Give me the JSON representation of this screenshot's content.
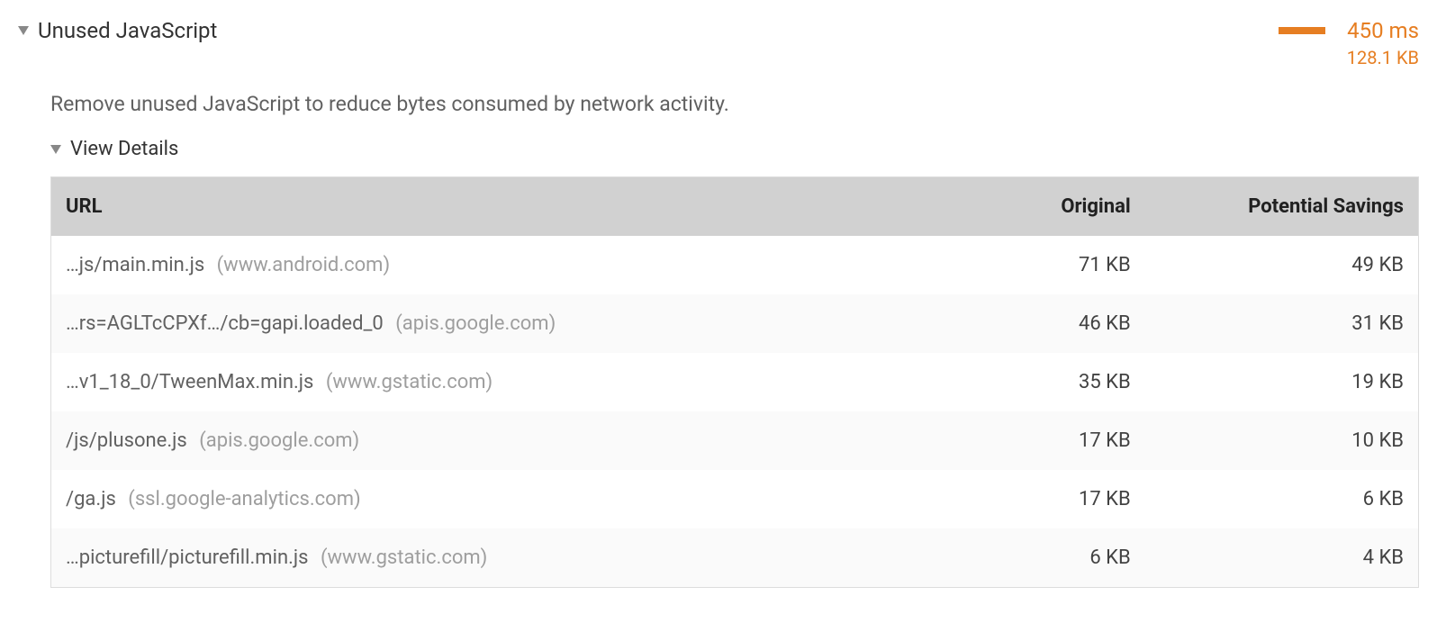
{
  "audit": {
    "title": "Unused JavaScript",
    "description": "Remove unused JavaScript to reduce bytes consumed by network activity.",
    "timing": "450 ms",
    "total_savings": "128.1 KB",
    "details_label": "View Details",
    "table": {
      "headers": {
        "url": "URL",
        "original": "Original",
        "savings": "Potential Savings"
      },
      "rows": [
        {
          "path": "…js/main.min.js",
          "host": "(www.android.com)",
          "original": "71 KB",
          "savings": "49 KB"
        },
        {
          "path": "…rs=AGLTcCPXf…/cb=gapi.loaded_0",
          "host": "(apis.google.com)",
          "original": "46 KB",
          "savings": "31 KB"
        },
        {
          "path": "…v1_18_0/TweenMax.min.js",
          "host": "(www.gstatic.com)",
          "original": "35 KB",
          "savings": "19 KB"
        },
        {
          "path": "/js/plusone.js",
          "host": "(apis.google.com)",
          "original": "17 KB",
          "savings": "10 KB"
        },
        {
          "path": "/ga.js",
          "host": "(ssl.google-analytics.com)",
          "original": "17 KB",
          "savings": "6 KB"
        },
        {
          "path": "…picturefill/picturefill.min.js",
          "host": "(www.gstatic.com)",
          "original": "6 KB",
          "savings": "4 KB"
        }
      ]
    }
  }
}
